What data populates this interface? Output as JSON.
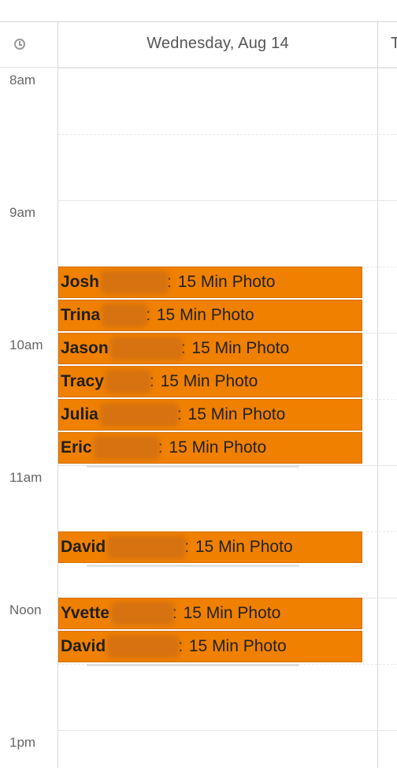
{
  "header": {
    "day_label": "Wednesday, Aug 14",
    "next_day_label": "T"
  },
  "time_labels": [
    "8am",
    "9am",
    "10am",
    "11am",
    "Noon",
    "1pm"
  ],
  "events": [
    {
      "name": "Josh",
      "separator": ":",
      "type": "15 Min Photo"
    },
    {
      "name": "Trina",
      "separator": ":",
      "type": "15 Min Photo"
    },
    {
      "name": "Jason",
      "separator": ":",
      "type": "15 Min Photo"
    },
    {
      "name": "Tracy",
      "separator": ":",
      "type": "15 Min Photo"
    },
    {
      "name": "Julia",
      "separator": ":",
      "type": "15 Min Photo"
    },
    {
      "name": "Eric",
      "separator": ":",
      "type": "15 Min Photo"
    },
    {
      "name": "David",
      "separator": ":",
      "type": "15 Min Photo"
    },
    {
      "name": "Yvette",
      "separator": ":",
      "type": "15 Min Photo"
    },
    {
      "name": "David",
      "separator": ":",
      "type": "15 Min Photo"
    }
  ],
  "colors": {
    "event_bg": "#f08000",
    "event_border": "#d27000",
    "grid": "#e6e6e6"
  }
}
